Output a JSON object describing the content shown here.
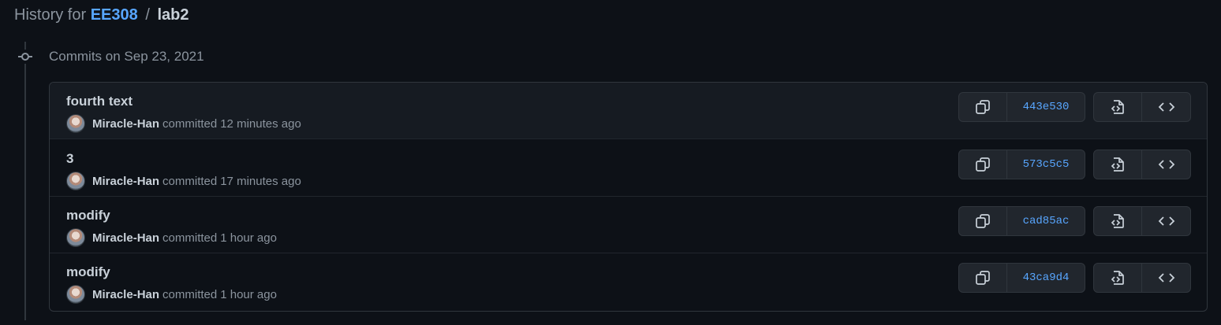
{
  "header": {
    "prefix": "History for",
    "repo": "EE308",
    "separator": "/",
    "path": "lab2"
  },
  "group": {
    "title": "Commits on Sep 23, 2021"
  },
  "commits": [
    {
      "title": "fourth text",
      "author": "Miracle-Han",
      "verb": "committed",
      "time": "12 minutes ago",
      "sha": "443e530"
    },
    {
      "title": "3",
      "author": "Miracle-Han",
      "verb": "committed",
      "time": "17 minutes ago",
      "sha": "573c5c5"
    },
    {
      "title": "modify",
      "author": "Miracle-Han",
      "verb": "committed",
      "time": "1 hour ago",
      "sha": "cad85ac"
    },
    {
      "title": "modify",
      "author": "Miracle-Han",
      "verb": "committed",
      "time": "1 hour ago",
      "sha": "43ca9d4"
    }
  ],
  "icons": {
    "commit_node": "git-commit-icon",
    "copy": "copy-icon",
    "view_files": "file-diff-icon",
    "browse_code": "code-icon",
    "avatar": "avatar"
  },
  "colors": {
    "background": "#0d1117",
    "row_highlight": "#161b22",
    "border": "#30363d",
    "link": "#58a6ff",
    "text": "#c9d1d9",
    "muted": "#8b949e"
  }
}
